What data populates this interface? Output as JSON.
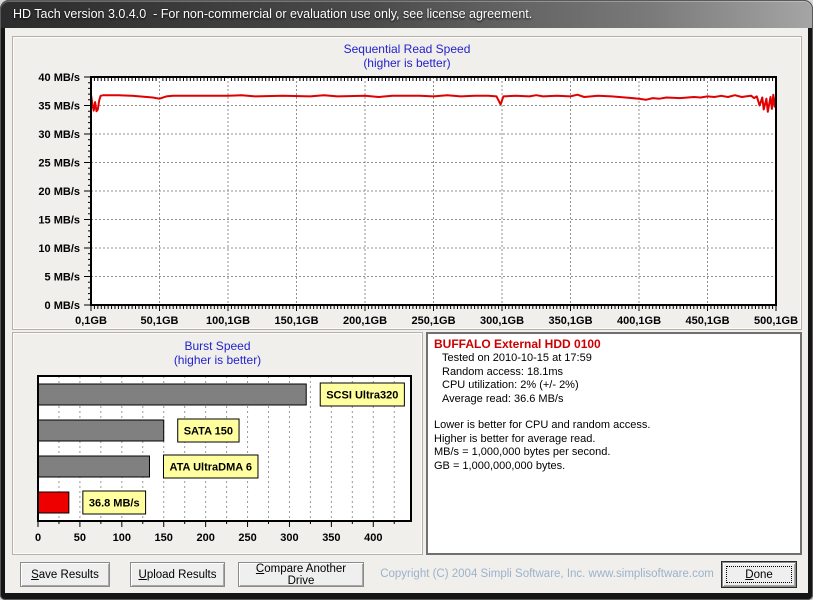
{
  "window": {
    "title": "HD Tach version 3.0.4.0  - For non-commercial or evaluation use only, see license agreement."
  },
  "colors": {
    "chart_title_blue": "#2222cc",
    "line_red": "#e00000",
    "bar_gray": "#808080",
    "bar_red": "#ee0000",
    "label_yellow": "#ffffa0",
    "grid_gray": "#909090",
    "drive_name_red": "#cc0000",
    "copyright_blue": "#9cb2cb"
  },
  "chart_data": [
    {
      "id": "sequential-read",
      "type": "line",
      "title": "Sequential Read Speed",
      "subtitle": "(higher is better)",
      "xlabel": "GB",
      "ylabel": "MB/s",
      "xlim": [
        0,
        500
      ],
      "ylim": [
        0,
        40
      ],
      "grid": true,
      "x_tick_values": [
        0,
        50,
        100,
        150,
        200,
        250,
        300,
        350,
        400,
        450,
        500
      ],
      "x_tick_labels": [
        "0,1GB",
        "50,1GB",
        "100,1GB",
        "150,1GB",
        "200,1GB",
        "250,1GB",
        "300,1GB",
        "350,1GB",
        "400,1GB",
        "450,1GB",
        "500,1GB"
      ],
      "y_tick_values": [
        0,
        5,
        10,
        15,
        20,
        25,
        30,
        35,
        40
      ],
      "y_tick_labels": [
        "0 MB/s",
        "5 MB/s",
        "10 MB/s",
        "15 MB/s",
        "20 MB/s",
        "25 MB/s",
        "30 MB/s",
        "35 MB/s",
        "40 MB/s"
      ],
      "series": [
        {
          "name": "read-speed",
          "color": "#e00000",
          "points": [
            [
              0,
              36.9
            ],
            [
              1,
              35.2
            ],
            [
              2,
              34.1
            ],
            [
              3,
              35.6
            ],
            [
              4,
              34.0
            ],
            [
              5,
              34.3
            ],
            [
              6,
              35.9
            ],
            [
              7,
              36.7
            ],
            [
              9,
              36.8
            ],
            [
              20,
              36.8
            ],
            [
              30,
              36.7
            ],
            [
              45,
              36.4
            ],
            [
              50,
              36.2
            ],
            [
              55,
              36.6
            ],
            [
              60,
              36.7
            ],
            [
              80,
              36.7
            ],
            [
              100,
              36.7
            ],
            [
              110,
              36.8
            ],
            [
              120,
              36.6
            ],
            [
              140,
              36.7
            ],
            [
              160,
              36.6
            ],
            [
              170,
              36.8
            ],
            [
              180,
              36.6
            ],
            [
              200,
              36.7
            ],
            [
              210,
              36.5
            ],
            [
              220,
              36.7
            ],
            [
              240,
              36.7
            ],
            [
              250,
              36.6
            ],
            [
              260,
              36.8
            ],
            [
              270,
              36.6
            ],
            [
              280,
              36.7
            ],
            [
              290,
              36.7
            ],
            [
              296,
              36.6
            ],
            [
              299,
              35.2
            ],
            [
              301,
              36.6
            ],
            [
              310,
              36.7
            ],
            [
              320,
              36.6
            ],
            [
              325,
              36.8
            ],
            [
              330,
              36.6
            ],
            [
              340,
              36.7
            ],
            [
              350,
              36.6
            ],
            [
              355,
              36.9
            ],
            [
              360,
              36.5
            ],
            [
              370,
              36.7
            ],
            [
              380,
              36.6
            ],
            [
              390,
              36.4
            ],
            [
              400,
              36.2
            ],
            [
              405,
              36.0
            ],
            [
              410,
              36.3
            ],
            [
              415,
              36.2
            ],
            [
              420,
              36.4
            ],
            [
              430,
              36.3
            ],
            [
              440,
              36.5
            ],
            [
              445,
              36.4
            ],
            [
              450,
              36.6
            ],
            [
              455,
              36.5
            ],
            [
              460,
              36.7
            ],
            [
              465,
              36.5
            ],
            [
              470,
              36.8
            ],
            [
              475,
              36.5
            ],
            [
              478,
              36.6
            ],
            [
              482,
              36.7
            ],
            [
              484,
              36.3
            ],
            [
              486,
              36.6
            ],
            [
              488,
              35.0
            ],
            [
              490,
              36.4
            ],
            [
              491,
              34.3
            ],
            [
              493,
              36.2
            ],
            [
              494,
              33.9
            ],
            [
              496,
              36.5
            ],
            [
              497,
              34.4
            ],
            [
              498,
              36.9
            ],
            [
              499,
              34.8
            ],
            [
              500,
              36.6
            ]
          ]
        }
      ]
    },
    {
      "id": "burst-speed",
      "type": "bar",
      "title": "Burst Speed",
      "subtitle": "(higher is better)",
      "categories": [
        "SCSI Ultra320",
        "SATA 150",
        "ATA UltraDMA 6",
        "36.8 MB/s"
      ],
      "values": [
        320,
        150,
        133,
        36.8
      ],
      "bar_colors": [
        "#808080",
        "#808080",
        "#808080",
        "#ee0000"
      ],
      "xlim": [
        0,
        445
      ],
      "grid_step": 25,
      "x_tick_values": [
        0,
        50,
        100,
        150,
        200,
        250,
        300,
        350,
        400
      ],
      "x_tick_labels": [
        "0",
        "50",
        "100",
        "150",
        "200",
        "250",
        "300",
        "350",
        "400"
      ]
    }
  ],
  "info_panel": {
    "drive_name": "BUFFALO External HDD 0100",
    "stats": [
      "Tested on 2010-10-15 at 17:59",
      "Random access: 18.1ms",
      "CPU utilization: 2% (+/- 2%)",
      "Average read: 36.6 MB/s"
    ],
    "notes": [
      "Lower is better for CPU and random access.",
      "Higher is better for average read.",
      "MB/s = 1,000,000 bytes per second.",
      "GB = 1,000,000,000 bytes."
    ]
  },
  "buttons": {
    "save": "Save Results",
    "upload": "Upload Results",
    "compare": "Compare Another Drive",
    "done": "Done"
  },
  "footer": {
    "copyright": "Copyright (C) 2004 Simpli Software, Inc. www.simplisoftware.com"
  }
}
